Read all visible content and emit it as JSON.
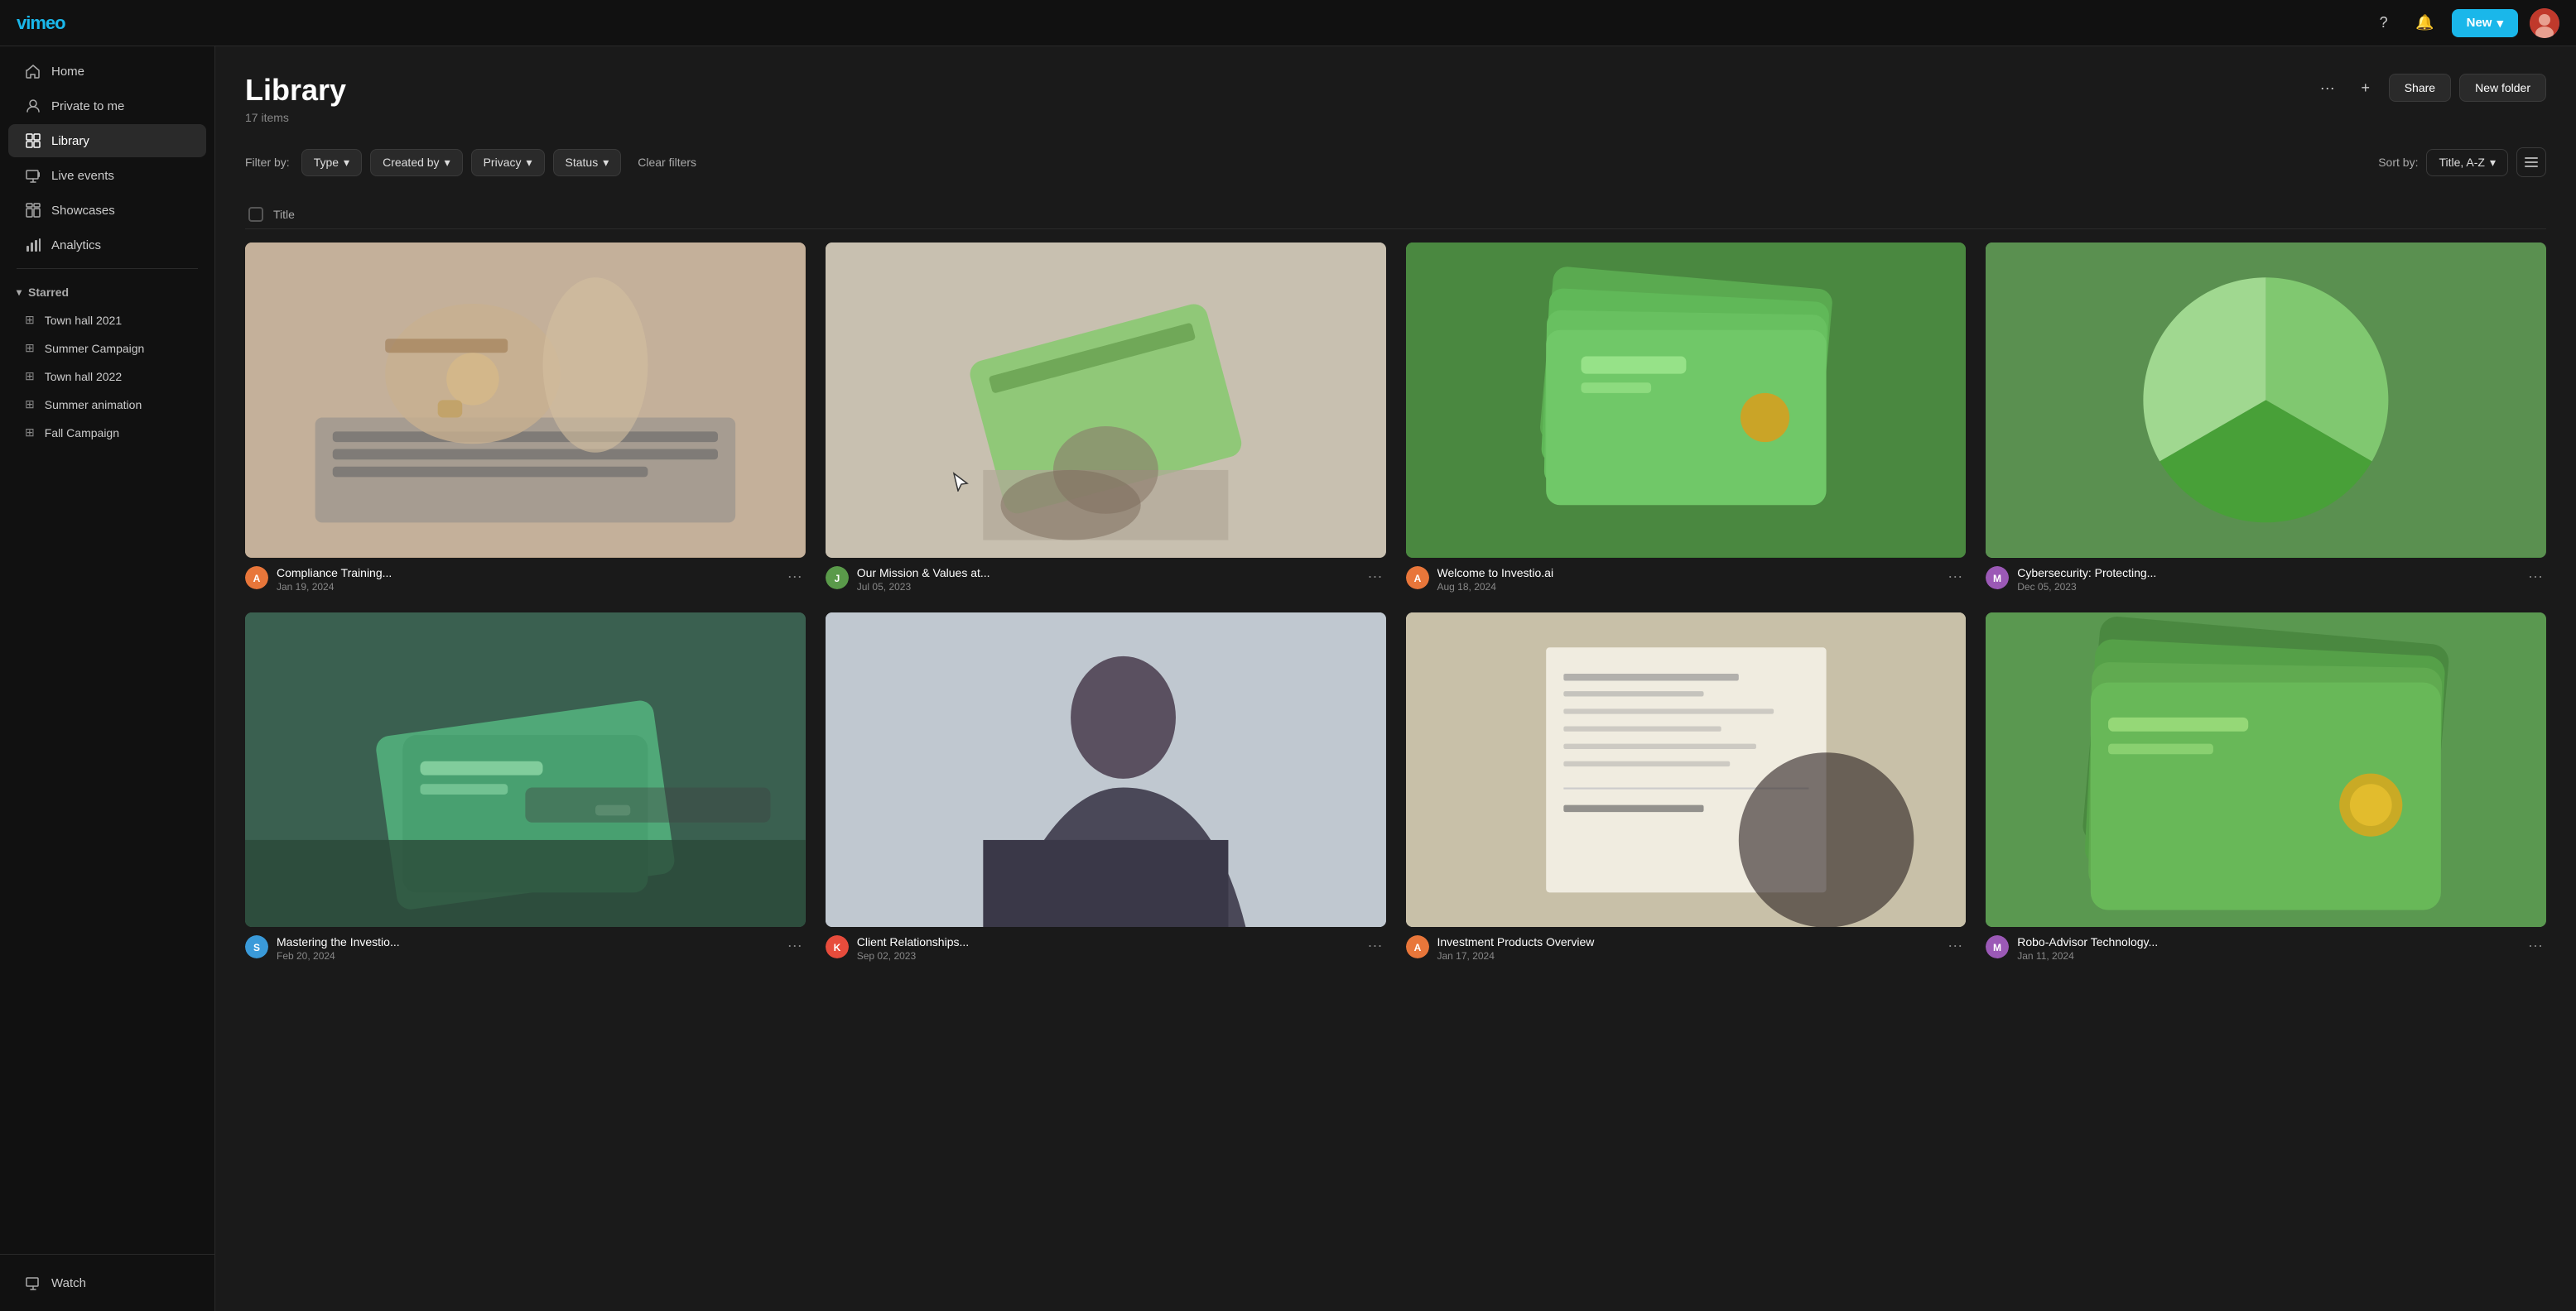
{
  "topbar": {
    "new_label": "New",
    "chevron": "▾"
  },
  "sidebar": {
    "logo": "vimeo",
    "nav_items": [
      {
        "id": "home",
        "label": "Home",
        "icon": "🏠"
      },
      {
        "id": "private",
        "label": "Private to me",
        "icon": "👤"
      },
      {
        "id": "library",
        "label": "Library",
        "icon": "⊞",
        "active": true
      },
      {
        "id": "live-events",
        "label": "Live events",
        "icon": "⊡"
      },
      {
        "id": "showcases",
        "label": "Showcases",
        "icon": "⊞"
      },
      {
        "id": "analytics",
        "label": "Analytics",
        "icon": "📊"
      }
    ],
    "starred": {
      "label": "Starred",
      "items": [
        {
          "id": "town-hall-2021",
          "label": "Town hall 2021"
        },
        {
          "id": "summer-campaign",
          "label": "Summer Campaign"
        },
        {
          "id": "town-hall-2022",
          "label": "Town hall 2022"
        },
        {
          "id": "summer-animation",
          "label": "Summer animation"
        },
        {
          "id": "fall-campaign",
          "label": "Fall Campaign"
        }
      ]
    },
    "bottom_item": {
      "id": "watch",
      "label": "Watch",
      "icon": "▶"
    }
  },
  "page": {
    "title": "Library",
    "subtitle": "17 items",
    "actions": {
      "more": "···",
      "add": "+",
      "share": "Share",
      "new_folder": "New folder"
    }
  },
  "filters": {
    "filter_by_label": "Filter by:",
    "type_label": "Type",
    "created_by_label": "Created by",
    "privacy_label": "Privacy",
    "status_label": "Status",
    "clear_label": "Clear filters",
    "sort_by_label": "Sort by:",
    "sort_value": "Title, A-Z",
    "chevron": "▾"
  },
  "table": {
    "title_col": "Title",
    "select_all": false
  },
  "videos": [
    {
      "id": "v1",
      "title": "Compliance Training...",
      "date": "Jan 19, 2024",
      "thumb_type": "keyboard",
      "avatar_color": "#e8763a"
    },
    {
      "id": "v2",
      "title": "Our Mission & Values at...",
      "date": "Jul 05, 2023",
      "thumb_type": "card-hand",
      "avatar_color": "#5a9a4a"
    },
    {
      "id": "v3",
      "title": "Welcome to Investio.ai",
      "date": "Aug 18, 2024",
      "thumb_type": "green-cards",
      "avatar_color": "#e8763a"
    },
    {
      "id": "v4",
      "title": "Cybersecurity: Protecting...",
      "date": "Dec 05, 2023",
      "thumb_type": "pie-chart",
      "avatar_color": "#9b59b6"
    },
    {
      "id": "v5",
      "title": "Mastering the Investio...",
      "date": "Feb 20, 2024",
      "thumb_type": "card-desk",
      "avatar_color": "#3a9ad9"
    },
    {
      "id": "v6",
      "title": "Client Relationships...",
      "date": "Sep 02, 2023",
      "thumb_type": "person",
      "avatar_color": "#e74c3c"
    },
    {
      "id": "v7",
      "title": "Investment Products Overview",
      "date": "Jan 17, 2024",
      "thumb_type": "receipt",
      "avatar_color": "#e8763a"
    },
    {
      "id": "v8",
      "title": "Robo-Advisor Technology...",
      "date": "Jan 11, 2024",
      "thumb_type": "stacked-cards",
      "avatar_color": "#9b59b6"
    }
  ]
}
